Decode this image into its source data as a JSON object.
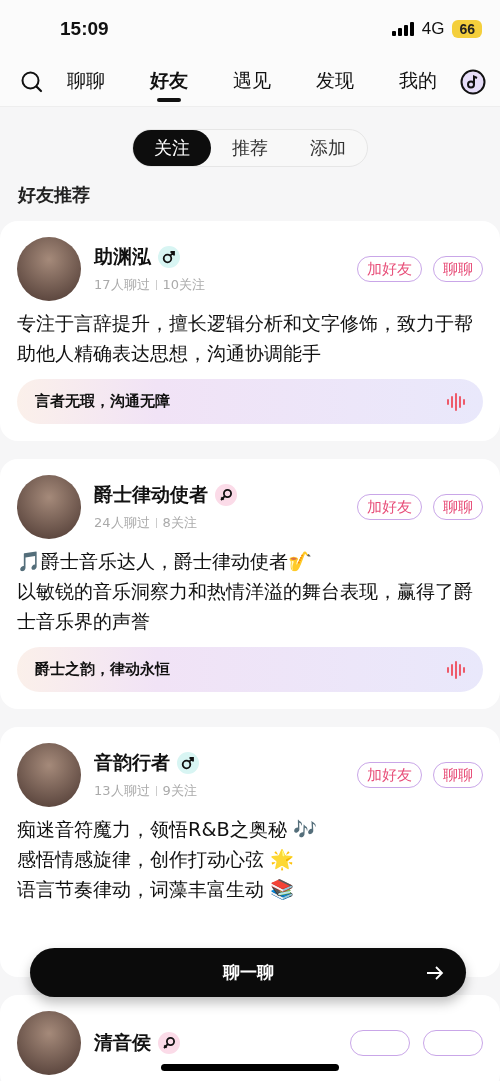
{
  "status_bar": {
    "time": "15:09",
    "network": "4G",
    "battery": "66"
  },
  "nav": {
    "tabs": [
      {
        "label": "聊聊",
        "selected": false
      },
      {
        "label": "好友",
        "selected": true
      },
      {
        "label": "遇见",
        "selected": false
      },
      {
        "label": "发现",
        "selected": false
      },
      {
        "label": "我的",
        "selected": false
      }
    ]
  },
  "segments": [
    {
      "label": "关注",
      "selected": true
    },
    {
      "label": "推荐",
      "selected": false
    },
    {
      "label": "添加",
      "selected": false
    }
  ],
  "section_title": "好友推荐",
  "cards": [
    {
      "name": "助渊泓",
      "gender_badge": {
        "kind": "male"
      },
      "chatted": "17人聊过",
      "following": "10关注",
      "add_button": "加好友",
      "chat_button": "聊聊",
      "bio": [
        "专注于言辞提升，擅长逻辑分析和文字修饰，致力于帮助他人精确表达思想，沟通协调能手"
      ],
      "quote": "言者无瑕，沟通无障"
    },
    {
      "name": "爵士律动使者",
      "gender_badge": {
        "kind": "female"
      },
      "chatted": "24人聊过",
      "following": "8关注",
      "add_button": "加好友",
      "chat_button": "聊聊",
      "bio": [
        "🎵爵士音乐达人，爵士律动使者🎷",
        "以敏锐的音乐洞察力和热情洋溢的舞台表现，赢得了爵士音乐界的声誉"
      ],
      "quote": "爵士之韵，律动永恒"
    },
    {
      "name": "音韵行者",
      "gender_badge": {
        "kind": "male"
      },
      "add_button": "加好友",
      "chat_button": "聊聊",
      "chatted": "13人聊过",
      "following": "9关注",
      "bio": [
        "痴迷音符魔力，领悟R&B之奥秘 🎶",
        "感悟情感旋律，创作打动心弦 🌟",
        "语言节奏律动，词藻丰富生动 📚"
      ]
    },
    {
      "name": "清音侯",
      "gender_badge": {
        "kind": "female"
      }
    }
  ],
  "chat_now_button": "聊一聊"
}
